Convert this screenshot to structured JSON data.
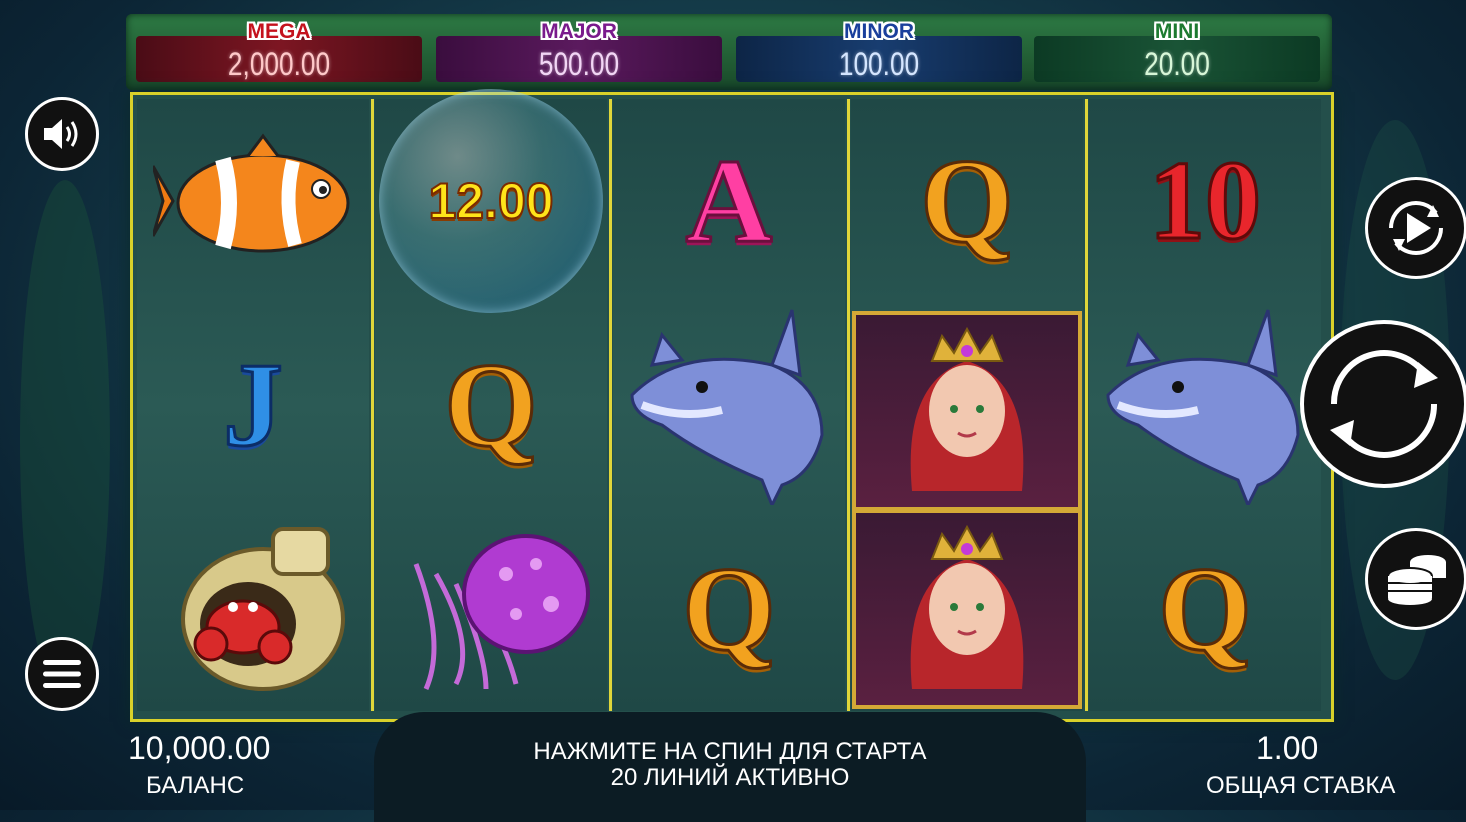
{
  "jackpots": [
    {
      "label": "MEGA",
      "value": "2,000.00"
    },
    {
      "label": "MAJOR",
      "value": "500.00"
    },
    {
      "label": "MINOR",
      "value": "100.00"
    },
    {
      "label": "MINI",
      "value": "20.00"
    }
  ],
  "reels": [
    [
      "clownfish",
      "J",
      "crab-in-vase"
    ],
    [
      "bubble-prize",
      "Q",
      "jellyfish"
    ],
    [
      "A",
      "dolphin",
      "Q"
    ],
    [
      "Q",
      "mermaid-queen",
      "mermaid-queen"
    ],
    [
      "10",
      "dolphin",
      "Q"
    ]
  ],
  "bubble_prize": "12.00",
  "symbols": {
    "q": "Q",
    "a": "A",
    "j": "J",
    "ten": "10"
  },
  "status": {
    "line1": "НАЖМИТЕ НА СПИН ДЛЯ СТАРТА",
    "line2": "20 ЛИНИЙ АКТИВНО"
  },
  "balance": {
    "value": "10,000.00",
    "label": "БАЛАНС"
  },
  "bet": {
    "value": "1.00",
    "label": "ОБЩАЯ СТАВКА"
  },
  "controls": {
    "sound": "speaker-icon",
    "menu": "hamburger-icon",
    "autoplay": "autoplay-icon",
    "spin": "spin-icon",
    "bet": "coins-icon"
  }
}
